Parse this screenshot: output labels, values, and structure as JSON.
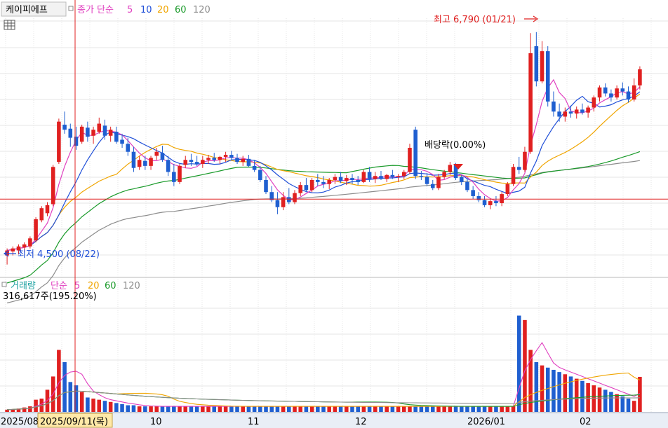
{
  "header": {
    "stock_name": "케이피에프",
    "price_label": "종가 단순",
    "ma_periods": [
      "5",
      "10",
      "20",
      "60",
      "120"
    ],
    "ma_colors": [
      "#e040c0",
      "#1f4fd8",
      "#f0a500",
      "#1a9a2a",
      "#8c8c8c"
    ]
  },
  "annotations": {
    "high": "최고 6,790 (01/21)",
    "low": "최저 4,500 (08/22)",
    "dividend": "배당락(0.00%)"
  },
  "volume_header": {
    "label": "거래량",
    "ma_label": "단순",
    "ma_periods": [
      "5",
      "20",
      "60",
      "120"
    ],
    "ma_colors": [
      "#e040c0",
      "#f0a500",
      "#1a9a2a",
      "#8c8c8c"
    ],
    "value_text": "316,617주(195.20%)"
  },
  "x_axis": {
    "labels": [
      "2025/08",
      "2025/09/11(목)",
      "10",
      "11",
      "12",
      "2026/01",
      "02"
    ]
  },
  "colors": {
    "up": "#e02020",
    "down": "#1f5fd0",
    "grid": "#e6e6e6",
    "crosshair": "#e02020",
    "cursor_bg": "#ffe9a8"
  },
  "chart_data": [
    {
      "type": "candlestick",
      "title": "케이피에프",
      "series_names": [
        "종가 단순 5",
        "10",
        "20",
        "60",
        "120"
      ],
      "ylim": [
        4380,
        6900
      ],
      "high": {
        "value": 6790,
        "date": "01/21"
      },
      "low": {
        "value": 4500,
        "date": "08/22"
      },
      "crosshair_price": 5130,
      "candles": [
        [
          4570,
          4640,
          4480,
          4620
        ],
        [
          4610,
          4660,
          4570,
          4640
        ],
        [
          4620,
          4680,
          4580,
          4660
        ],
        [
          4650,
          4700,
          4600,
          4680
        ],
        [
          4660,
          4760,
          4640,
          4740
        ],
        [
          4720,
          4950,
          4700,
          4930
        ],
        [
          4920,
          5060,
          4900,
          5040
        ],
        [
          4990,
          5100,
          4960,
          5070
        ],
        [
          5080,
          5470,
          5060,
          5450
        ],
        [
          5500,
          5930,
          5480,
          5900
        ],
        [
          5870,
          6000,
          5780,
          5820
        ],
        [
          5830,
          5880,
          5650,
          5740
        ],
        [
          5750,
          5850,
          5620,
          5660
        ],
        [
          5700,
          5870,
          5680,
          5850
        ],
        [
          5840,
          5900,
          5700,
          5750
        ],
        [
          5760,
          5850,
          5680,
          5820
        ],
        [
          5800,
          5940,
          5780,
          5880
        ],
        [
          5860,
          5920,
          5720,
          5760
        ],
        [
          5760,
          5850,
          5700,
          5820
        ],
        [
          5800,
          5850,
          5680,
          5700
        ],
        [
          5720,
          5780,
          5640,
          5680
        ],
        [
          5680,
          5740,
          5560,
          5600
        ],
        [
          5600,
          5650,
          5400,
          5440
        ],
        [
          5450,
          5560,
          5420,
          5520
        ],
        [
          5510,
          5560,
          5420,
          5460
        ],
        [
          5460,
          5560,
          5420,
          5540
        ],
        [
          5560,
          5640,
          5520,
          5600
        ],
        [
          5590,
          5660,
          5500,
          5520
        ],
        [
          5520,
          5560,
          5360,
          5400
        ],
        [
          5400,
          5480,
          5260,
          5300
        ],
        [
          5300,
          5480,
          5280,
          5460
        ],
        [
          5470,
          5560,
          5440,
          5520
        ],
        [
          5520,
          5580,
          5460,
          5500
        ],
        [
          5500,
          5560,
          5460,
          5480
        ],
        [
          5480,
          5560,
          5440,
          5520
        ],
        [
          5520,
          5570,
          5480,
          5540
        ],
        [
          5540,
          5590,
          5500,
          5520
        ],
        [
          5520,
          5560,
          5480,
          5550
        ],
        [
          5550,
          5600,
          5500,
          5570
        ],
        [
          5570,
          5610,
          5520,
          5540
        ],
        [
          5540,
          5580,
          5480,
          5500
        ],
        [
          5500,
          5560,
          5460,
          5530
        ],
        [
          5530,
          5570,
          5450,
          5460
        ],
        [
          5460,
          5520,
          5400,
          5420
        ],
        [
          5420,
          5460,
          5300,
          5320
        ],
        [
          5320,
          5360,
          5180,
          5200
        ],
        [
          5200,
          5260,
          5100,
          5120
        ],
        [
          5120,
          5200,
          4980,
          5050
        ],
        [
          5050,
          5200,
          5020,
          5150
        ],
        [
          5150,
          5240,
          5080,
          5100
        ],
        [
          5100,
          5220,
          5080,
          5190
        ],
        [
          5190,
          5300,
          5160,
          5270
        ],
        [
          5270,
          5340,
          5200,
          5220
        ],
        [
          5220,
          5340,
          5200,
          5320
        ],
        [
          5320,
          5380,
          5260,
          5300
        ],
        [
          5300,
          5360,
          5240,
          5280
        ],
        [
          5280,
          5340,
          5230,
          5320
        ],
        [
          5320,
          5380,
          5280,
          5350
        ],
        [
          5350,
          5400,
          5290,
          5310
        ],
        [
          5310,
          5370,
          5270,
          5340
        ],
        [
          5340,
          5380,
          5280,
          5320
        ],
        [
          5320,
          5360,
          5270,
          5300
        ],
        [
          5300,
          5420,
          5290,
          5400
        ],
        [
          5400,
          5450,
          5300,
          5330
        ],
        [
          5330,
          5400,
          5290,
          5360
        ],
        [
          5360,
          5410,
          5320,
          5330
        ],
        [
          5330,
          5380,
          5300,
          5370
        ],
        [
          5370,
          5420,
          5330,
          5350
        ],
        [
          5350,
          5380,
          5300,
          5360
        ],
        [
          5360,
          5420,
          5330,
          5400
        ],
        [
          5400,
          5680,
          5380,
          5640
        ],
        [
          5820,
          5850,
          5330,
          5360
        ],
        [
          5360,
          5410,
          5320,
          5350
        ],
        [
          5350,
          5390,
          5260,
          5280
        ],
        [
          5280,
          5320,
          5220,
          5240
        ],
        [
          5240,
          5380,
          5220,
          5350
        ],
        [
          5350,
          5420,
          5330,
          5400
        ],
        [
          5400,
          5500,
          5370,
          5470
        ],
        [
          5470,
          5490,
          5320,
          5340
        ],
        [
          5350,
          5370,
          5270,
          5300
        ],
        [
          5300,
          5340,
          5200,
          5220
        ],
        [
          5220,
          5260,
          5130,
          5160
        ],
        [
          5160,
          5200,
          5100,
          5120
        ],
        [
          5120,
          5160,
          5050,
          5070
        ],
        [
          5070,
          5130,
          5030,
          5110
        ],
        [
          5110,
          5160,
          5060,
          5090
        ],
        [
          5090,
          5200,
          5060,
          5180
        ],
        [
          5180,
          5300,
          5160,
          5280
        ],
        [
          5280,
          5480,
          5260,
          5450
        ],
        [
          5450,
          5550,
          5380,
          5420
        ],
        [
          5420,
          5650,
          5400,
          5600
        ],
        [
          5600,
          6780,
          5580,
          6580
        ],
        [
          6650,
          6790,
          6250,
          6300
        ],
        [
          6300,
          6700,
          6280,
          6600
        ],
        [
          6600,
          6650,
          6050,
          6100
        ],
        [
          6100,
          6200,
          5950,
          6000
        ],
        [
          6000,
          6080,
          5900,
          5950
        ],
        [
          5950,
          6040,
          5900,
          6000
        ],
        [
          6000,
          6060,
          5940,
          5980
        ],
        [
          5980,
          6050,
          5930,
          6020
        ],
        [
          6020,
          6080,
          5970,
          5990
        ],
        [
          5990,
          6060,
          5940,
          6040
        ],
        [
          6040,
          6160,
          6000,
          6140
        ],
        [
          6140,
          6260,
          6100,
          6240
        ],
        [
          6240,
          6280,
          6150,
          6180
        ],
        [
          6180,
          6220,
          6100,
          6140
        ],
        [
          6140,
          6260,
          6120,
          6230
        ],
        [
          6230,
          6290,
          6160,
          6200
        ],
        [
          6200,
          6250,
          6090,
          6120
        ],
        [
          6120,
          6330,
          6100,
          6260
        ],
        [
          6260,
          6450,
          6220,
          6420
        ]
      ]
    },
    {
      "type": "bar",
      "title": "거래량",
      "series_names": [
        "거래량",
        "단순 5",
        "20",
        "60",
        "120"
      ],
      "value_text": "316,617주(195.20%)",
      "ylim": [
        0,
        1000000
      ],
      "volumes": [
        20000,
        25000,
        30000,
        40000,
        50000,
        110000,
        120000,
        200000,
        320000,
        560000,
        450000,
        270000,
        240000,
        180000,
        130000,
        120000,
        110000,
        100000,
        90000,
        80000,
        70000,
        60000,
        60000,
        50000,
        50000,
        50000,
        50000,
        50000,
        50000,
        50000,
        50000,
        50000,
        50000,
        50000,
        50000,
        50000,
        50000,
        50000,
        50000,
        50000,
        50000,
        50000,
        50000,
        50000,
        50000,
        50000,
        50000,
        50000,
        50000,
        50000,
        50000,
        50000,
        50000,
        50000,
        50000,
        50000,
        50000,
        50000,
        50000,
        50000,
        50000,
        50000,
        50000,
        50000,
        50000,
        50000,
        50000,
        50000,
        50000,
        50000,
        50000,
        50000,
        50000,
        50000,
        50000,
        50000,
        50000,
        50000,
        50000,
        50000,
        50000,
        50000,
        50000,
        50000,
        50000,
        50000,
        50000,
        50000,
        50000,
        870000,
        830000,
        560000,
        450000,
        420000,
        400000,
        380000,
        360000,
        340000,
        320000,
        300000,
        280000,
        260000,
        240000,
        220000,
        200000,
        180000,
        160000,
        140000,
        120000,
        100000,
        316617
      ]
    }
  ]
}
